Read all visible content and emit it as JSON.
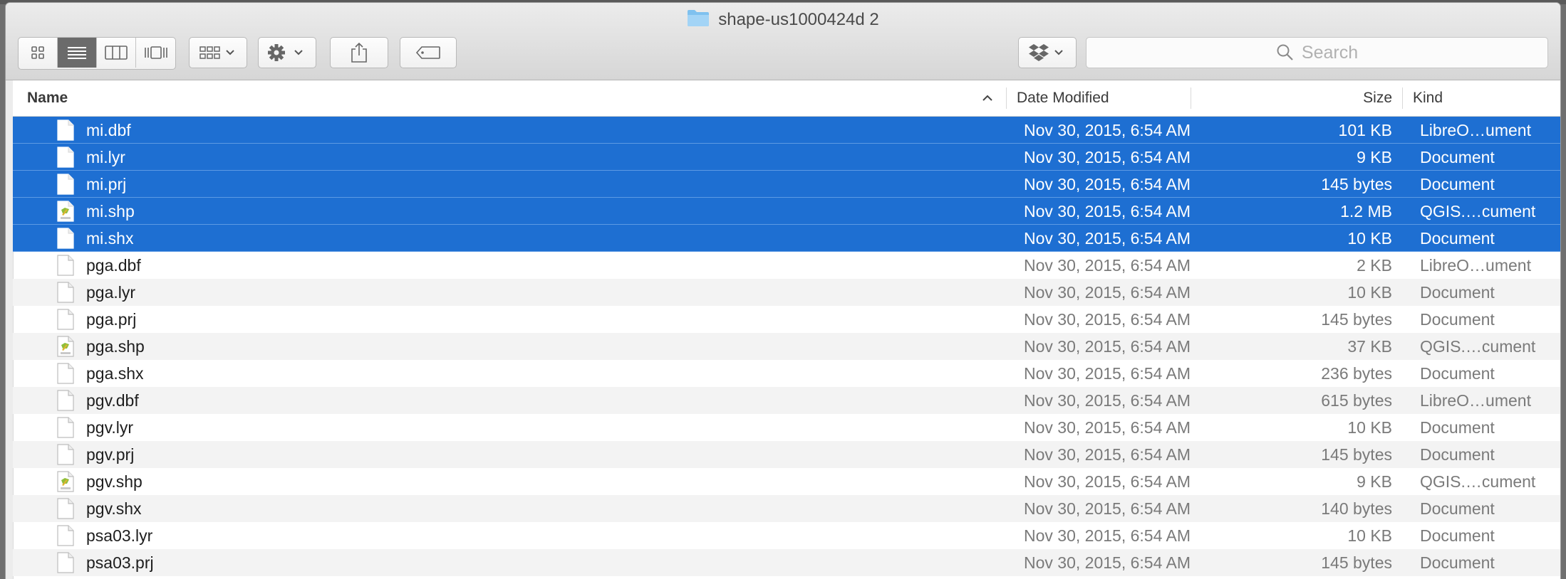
{
  "window": {
    "title": "shape-us1000424d 2"
  },
  "toolbar": {
    "view_buttons": [
      "icon-view",
      "list-view",
      "column-view",
      "cover-flow-view"
    ],
    "active_view": "list-view",
    "arrange_icon": "arrange-grid-icon",
    "action_icon": "gear-icon",
    "share_icon": "share-icon",
    "tag_icon": "tag-icon",
    "dropbox_icon": "dropbox-icon",
    "search": {
      "placeholder": "Search"
    }
  },
  "columns": {
    "name": "Name",
    "date": "Date Modified",
    "size": "Size",
    "kind": "Kind",
    "sort": "ascending"
  },
  "colors": {
    "selection": "#1e6fd2",
    "alt_row": "#f3f3f3"
  },
  "files": [
    {
      "name": "mi.dbf",
      "date": "Nov 30, 2015, 6:54 AM",
      "size": "101 KB",
      "kind": "LibreO…ument",
      "icon": "document-icon",
      "selected": true
    },
    {
      "name": "mi.lyr",
      "date": "Nov 30, 2015, 6:54 AM",
      "size": "9 KB",
      "kind": "Document",
      "icon": "document-icon",
      "selected": true
    },
    {
      "name": "mi.prj",
      "date": "Nov 30, 2015, 6:54 AM",
      "size": "145 bytes",
      "kind": "Document",
      "icon": "document-icon",
      "selected": true
    },
    {
      "name": "mi.shp",
      "date": "Nov 30, 2015, 6:54 AM",
      "size": "1.2 MB",
      "kind": "QGIS.…cument",
      "icon": "qgis-document-icon",
      "selected": true
    },
    {
      "name": "mi.shx",
      "date": "Nov 30, 2015, 6:54 AM",
      "size": "10 KB",
      "kind": "Document",
      "icon": "document-icon",
      "selected": true
    },
    {
      "name": "pga.dbf",
      "date": "Nov 30, 2015, 6:54 AM",
      "size": "2 KB",
      "kind": "LibreO…ument",
      "icon": "document-icon",
      "selected": false
    },
    {
      "name": "pga.lyr",
      "date": "Nov 30, 2015, 6:54 AM",
      "size": "10 KB",
      "kind": "Document",
      "icon": "document-icon",
      "selected": false
    },
    {
      "name": "pga.prj",
      "date": "Nov 30, 2015, 6:54 AM",
      "size": "145 bytes",
      "kind": "Document",
      "icon": "document-icon",
      "selected": false
    },
    {
      "name": "pga.shp",
      "date": "Nov 30, 2015, 6:54 AM",
      "size": "37 KB",
      "kind": "QGIS.…cument",
      "icon": "qgis-document-icon",
      "selected": false
    },
    {
      "name": "pga.shx",
      "date": "Nov 30, 2015, 6:54 AM",
      "size": "236 bytes",
      "kind": "Document",
      "icon": "document-icon",
      "selected": false
    },
    {
      "name": "pgv.dbf",
      "date": "Nov 30, 2015, 6:54 AM",
      "size": "615 bytes",
      "kind": "LibreO…ument",
      "icon": "document-icon",
      "selected": false
    },
    {
      "name": "pgv.lyr",
      "date": "Nov 30, 2015, 6:54 AM",
      "size": "10 KB",
      "kind": "Document",
      "icon": "document-icon",
      "selected": false
    },
    {
      "name": "pgv.prj",
      "date": "Nov 30, 2015, 6:54 AM",
      "size": "145 bytes",
      "kind": "Document",
      "icon": "document-icon",
      "selected": false
    },
    {
      "name": "pgv.shp",
      "date": "Nov 30, 2015, 6:54 AM",
      "size": "9 KB",
      "kind": "QGIS.…cument",
      "icon": "qgis-document-icon",
      "selected": false
    },
    {
      "name": "pgv.shx",
      "date": "Nov 30, 2015, 6:54 AM",
      "size": "140 bytes",
      "kind": "Document",
      "icon": "document-icon",
      "selected": false
    },
    {
      "name": "psa03.lyr",
      "date": "Nov 30, 2015, 6:54 AM",
      "size": "10 KB",
      "kind": "Document",
      "icon": "document-icon",
      "selected": false
    },
    {
      "name": "psa03.prj",
      "date": "Nov 30, 2015, 6:54 AM",
      "size": "145 bytes",
      "kind": "Document",
      "icon": "document-icon",
      "selected": false
    }
  ]
}
